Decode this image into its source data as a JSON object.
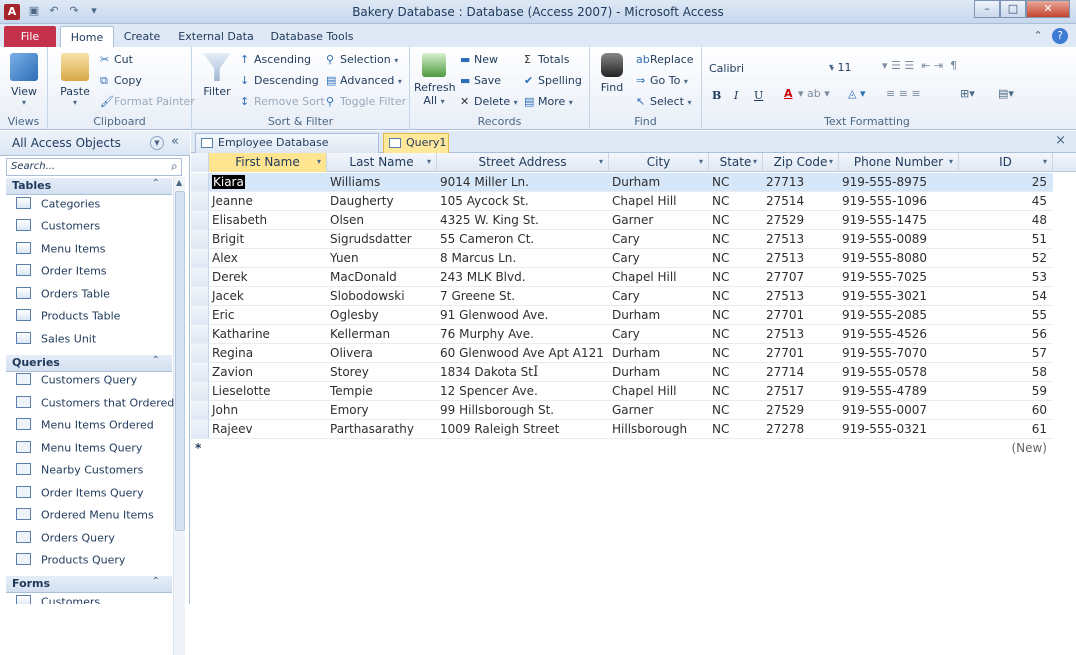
{
  "window": {
    "app_icon": "A",
    "title": "Bakery Database : Database (Access 2007)  -  Microsoft Access"
  },
  "ribbon_tabs": [
    "File",
    "Home",
    "Create",
    "External Data",
    "Database Tools"
  ],
  "ribbon": {
    "views": {
      "view": "View",
      "group": "Views"
    },
    "clipboard": {
      "paste": "Paste",
      "cut": "Cut",
      "copy": "Copy",
      "format_painter": "Format Painter",
      "group": "Clipboard"
    },
    "sort_filter": {
      "filter": "Filter",
      "ascending": "Ascending",
      "descending": "Descending",
      "remove_sort": "Remove Sort",
      "selection": "Selection",
      "advanced": "Advanced",
      "toggle_filter": "Toggle Filter",
      "group": "Sort & Filter"
    },
    "records": {
      "refresh": "Refresh",
      "refresh_all": "All",
      "new": "New",
      "save": "Save",
      "delete": "Delete",
      "totals": "Totals",
      "spelling": "Spelling",
      "more": "More",
      "group": "Records"
    },
    "find": {
      "find": "Find",
      "replace": "Replace",
      "goto": "Go To",
      "select": "Select",
      "group": "Find"
    },
    "text_formatting": {
      "font": "Calibri",
      "size": "11",
      "bold": "B",
      "italic": "I",
      "underline": "U",
      "group": "Text Formatting"
    }
  },
  "nav": {
    "title": "All Access Objects",
    "search_placeholder": "Search...",
    "sections": [
      {
        "name": "Tables",
        "items": [
          "Categories",
          "Customers",
          "Menu Items",
          "Order Items",
          "Orders Table",
          "Products Table",
          "Sales Unit"
        ]
      },
      {
        "name": "Queries",
        "items": [
          "Customers Query",
          "Customers that Ordered",
          "Menu Items Ordered",
          "Menu Items Query",
          "Nearby Customers",
          "Order Items Query",
          "Ordered Menu Items",
          "Orders Query",
          "Products Query"
        ]
      },
      {
        "name": "Forms",
        "items": [
          "Customers"
        ]
      }
    ]
  },
  "doc_tabs": [
    "Employee Database Navigation",
    "Query1"
  ],
  "columns": [
    "First Name",
    "Last Name",
    "Street Address",
    "City",
    "State",
    "Zip Code",
    "Phone Number",
    "ID"
  ],
  "rows": [
    [
      "Kiara",
      "Williams",
      "9014 Miller Ln.",
      "Durham",
      "NC",
      "27713",
      "919-555-8975",
      "25"
    ],
    [
      "Jeanne",
      "Daugherty",
      "105 Aycock St.",
      "Chapel Hill",
      "NC",
      "27514",
      "919-555-1096",
      "45"
    ],
    [
      "Elisabeth",
      "Olsen",
      "4325 W. King St.",
      "Garner",
      "NC",
      "27529",
      "919-555-1475",
      "48"
    ],
    [
      "Brigit",
      "Sigrudsdatter",
      "55 Cameron Ct.",
      "Cary",
      "NC",
      "27513",
      "919-555-0089",
      "51"
    ],
    [
      "Alex",
      "Yuen",
      "8 Marcus Ln.",
      "Cary",
      "NC",
      "27513",
      "919-555-8080",
      "52"
    ],
    [
      "Derek",
      "MacDonald",
      "243 MLK Blvd.",
      "Chapel Hill",
      "NC",
      "27707",
      "919-555-7025",
      "53"
    ],
    [
      "Jacek",
      "Slobodowski",
      "7 Greene St.",
      "Cary",
      "NC",
      "27513",
      "919-555-3021",
      "54"
    ],
    [
      "Eric",
      "Oglesby",
      "91 Glenwood Ave.",
      "Durham",
      "NC",
      "27701",
      "919-555-2085",
      "55"
    ],
    [
      "Katharine",
      "Kellerman",
      "76 Murphy Ave.",
      "Cary",
      "NC",
      "27513",
      "919-555-4526",
      "56"
    ],
    [
      "Regina",
      "Olivera",
      "60 Glenwood Ave Apt A121",
      "Durham",
      "NC",
      "27701",
      "919-555-7070",
      "57"
    ],
    [
      "Zavion",
      "Storey",
      "1834 Dakota St.",
      "Durham",
      "NC",
      "27714",
      "919-555-0578",
      "58"
    ],
    [
      "Lieselotte",
      "Tempie",
      "12 Spencer Ave.",
      "Chapel Hill",
      "NC",
      "27517",
      "919-555-4789",
      "59"
    ],
    [
      "John",
      "Emory",
      "99 Hillsborough St.",
      "Garner",
      "NC",
      "27529",
      "919-555-0007",
      "60"
    ],
    [
      "Rajeev",
      "Parthasarathy",
      "1009 Raleigh Street",
      "Hillsborough",
      "NC",
      "27278",
      "919-555-0321",
      "61"
    ]
  ],
  "new_row": {
    "marker": "*",
    "id": "(New)"
  }
}
